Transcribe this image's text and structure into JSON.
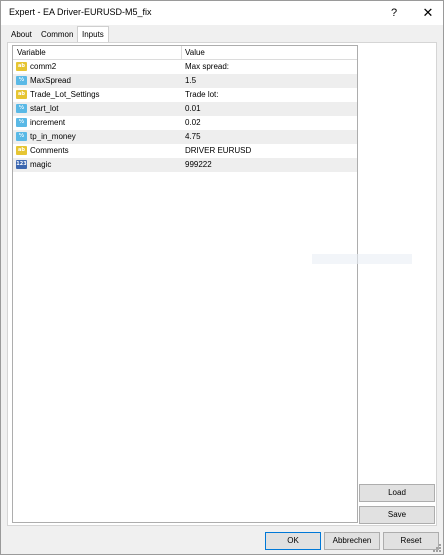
{
  "window": {
    "title": "Expert - EA Driver-EURUSD-M5_fix",
    "help_glyph": "?",
    "close_glyph": "✕"
  },
  "tabs": [
    {
      "label": "About"
    },
    {
      "label": "Common"
    },
    {
      "label": "Inputs",
      "active": true
    }
  ],
  "table": {
    "headers": {
      "variable": "Variable",
      "value": "Value"
    },
    "rows": [
      {
        "icon": "ab-string-icon",
        "icon_text": "ab",
        "variable": "comm2",
        "value": "Max spread:"
      },
      {
        "icon": "v2-double-icon",
        "icon_text": "½",
        "variable": "MaxSpread",
        "value": "1.5"
      },
      {
        "icon": "ab-string-icon",
        "icon_text": "ab",
        "variable": "Trade_Lot_Settings",
        "value": "Trade lot:"
      },
      {
        "icon": "v2-double-icon",
        "icon_text": "½",
        "variable": "start_lot",
        "value": "0.01"
      },
      {
        "icon": "v2-double-icon",
        "icon_text": "½",
        "variable": "increment",
        "value": "0.02"
      },
      {
        "icon": "v2-double-icon",
        "icon_text": "½",
        "variable": "tp_in_money",
        "value": "4.75"
      },
      {
        "icon": "ab-string-icon",
        "icon_text": "ab",
        "variable": "Comments",
        "value": "DRIVER EURUSD"
      },
      {
        "icon": "123-integer-icon",
        "icon_text": "123",
        "variable": "magic",
        "value": "999222"
      }
    ]
  },
  "side_buttons": {
    "load": "Load",
    "save": "Save"
  },
  "footer_buttons": {
    "ok": "OK",
    "cancel": "Abbrechen",
    "reset": "Reset"
  }
}
